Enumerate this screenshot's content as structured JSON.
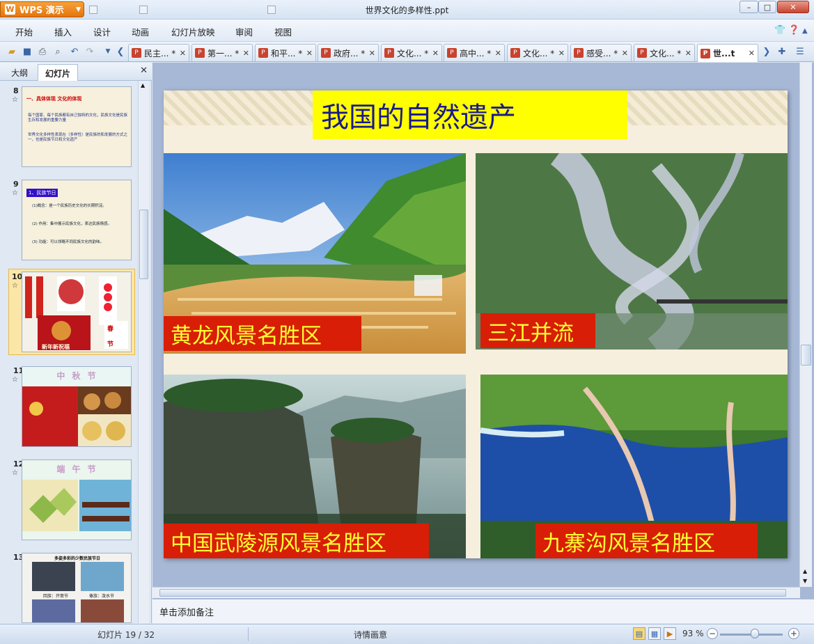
{
  "window": {
    "app_name": "WPS 演示",
    "doc_title": "世界文化的多样性.ppt",
    "controls": [
      "–",
      "□",
      "✕"
    ]
  },
  "menu": {
    "items": [
      "开始",
      "插入",
      "设计",
      "动画",
      "幻灯片放映",
      "审阅",
      "视图"
    ],
    "right_icons": [
      "shirt-icon",
      "help-icon",
      "minimize-ribbon-icon"
    ]
  },
  "doc_tabs": [
    {
      "label": "民主... *"
    },
    {
      "label": "第一... *"
    },
    {
      "label": "和平... *"
    },
    {
      "label": "政府... *"
    },
    {
      "label": "文化... *"
    },
    {
      "label": "高中... *"
    },
    {
      "label": "文化... *"
    },
    {
      "label": "感受... *"
    },
    {
      "label": "文化... *"
    },
    {
      "label": "世...t",
      "active": true
    }
  ],
  "left_panel": {
    "tabs": [
      "大纲",
      "幻灯片"
    ],
    "active_tab": "幻灯片",
    "close": "✕",
    "thumbs": [
      {
        "num": "8",
        "lines": [
          "一、具体体现   文化的体现",
          "每个国家、每个民族都有自己独特的文化，民族文化是民族生存和发展的重要力量",
          "世界文化多样性表现在（多样性）是民族的和发展的方式之一，也是民族节日和文化遗产"
        ]
      },
      {
        "num": "9",
        "heading": "1、民族节日",
        "lines": [
          "(1)概念：是一个民族历史文化的长期积淀。",
          "(2) 作用：集中展示民族文化，表达民族情感。",
          "(3) 功能：可以领略不同民族文化的韵味。"
        ]
      },
      {
        "num": "10",
        "labels": [
          "春",
          "节",
          "新年新祝福"
        ]
      },
      {
        "num": "11",
        "title": "中 秋 节"
      },
      {
        "num": "12",
        "title": "端 午 节"
      },
      {
        "num": "13",
        "title": "多姿多彩的少数民族节日",
        "labels": [
          "回族：开斋节",
          "傣族：泼水节"
        ]
      }
    ]
  },
  "slide": {
    "title": "我国的自然遗产",
    "captions": [
      "黄龙风景名胜区",
      "三江并流",
      "中国武陵源风景名胜区",
      "九寨沟风景名胜区"
    ]
  },
  "notes": {
    "placeholder": "单击添加备注"
  },
  "status": {
    "slide_indicator": "幻灯片 19 / 32",
    "theme": "诗情画意",
    "zoom": "93 %",
    "zoom_level": 0.55
  },
  "colors": {
    "wps_orange": "#e5750c",
    "slide_title_bg": "#ffff00",
    "slide_title_text": "#1a1a8a",
    "caption_bg": "#d81e06",
    "caption_text": "#ffff33"
  }
}
